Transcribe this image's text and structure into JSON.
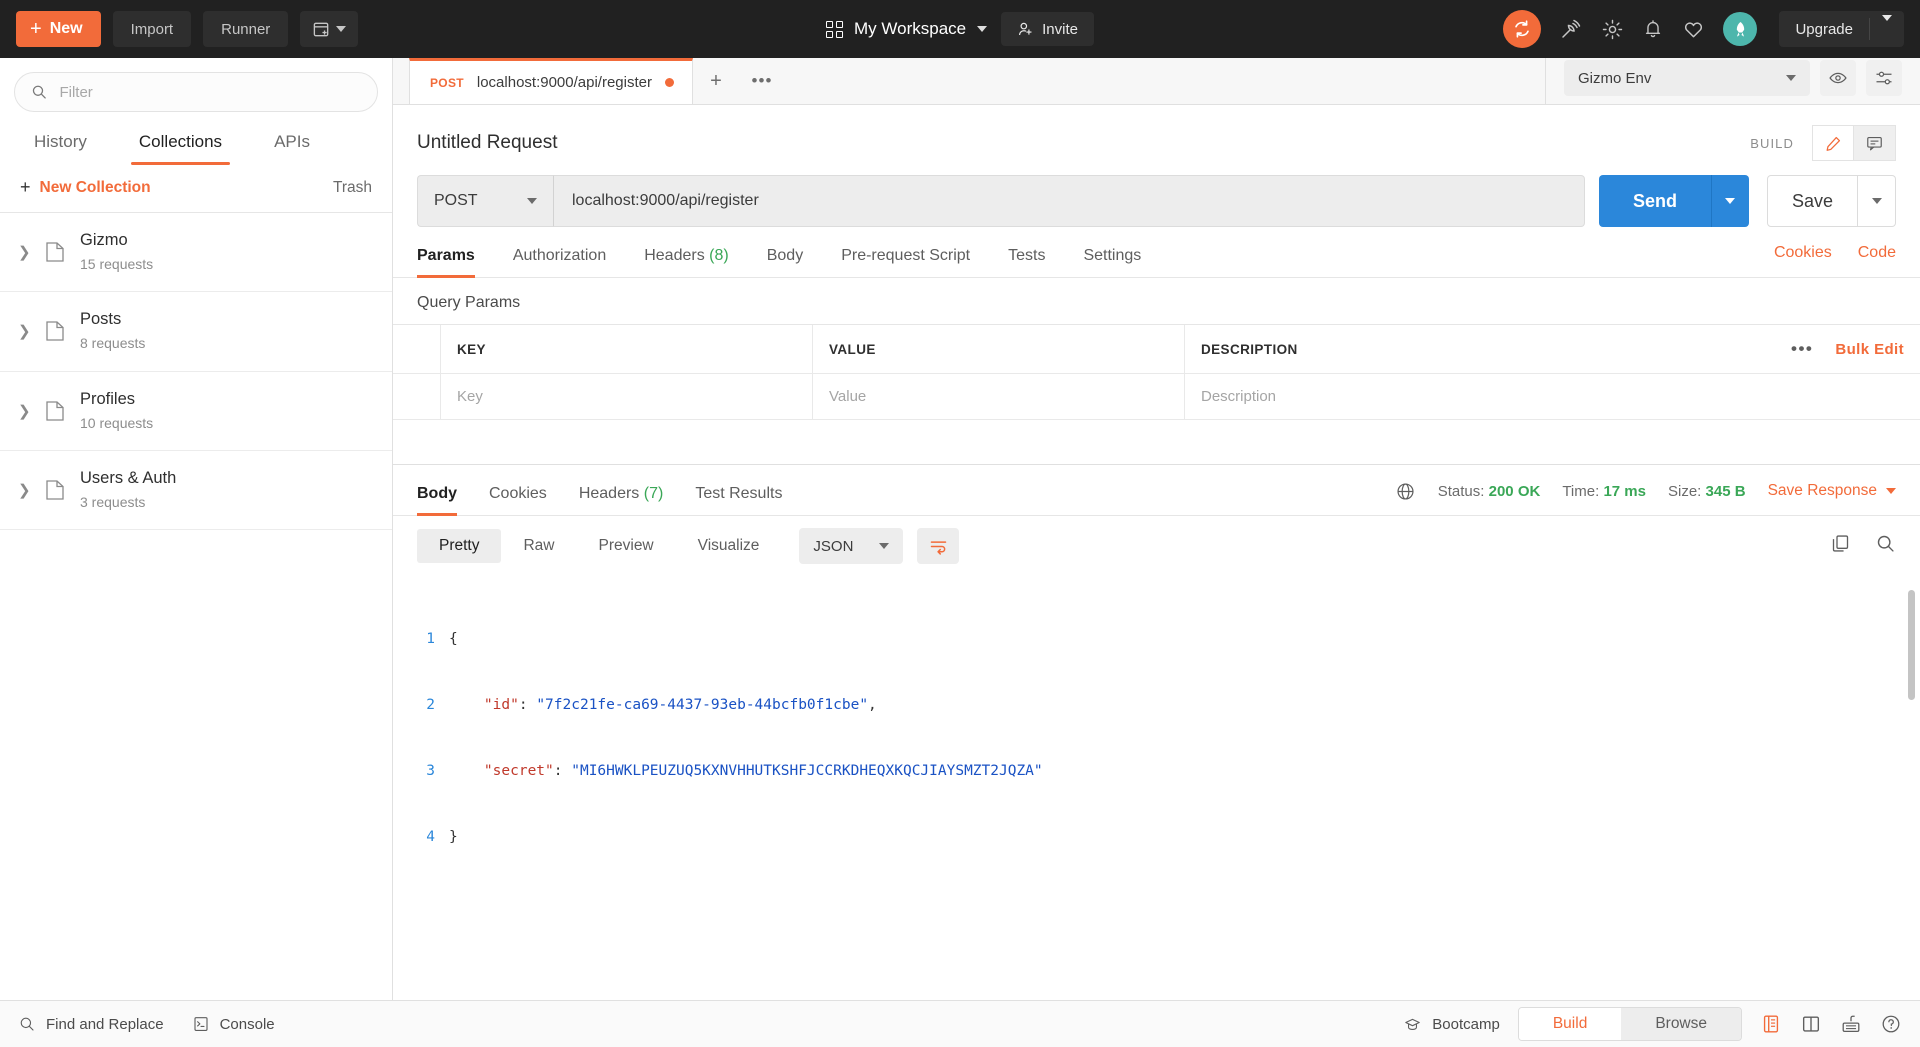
{
  "topbar": {
    "new_label": "New",
    "import_label": "Import",
    "runner_label": "Runner",
    "workspace_label": "My Workspace",
    "invite_label": "Invite",
    "upgrade_label": "Upgrade",
    "icons": [
      "sync-icon",
      "satellite-icon",
      "gear-icon",
      "bell-icon",
      "heart-icon",
      "rocket-avatar"
    ],
    "accent": "#f26b3a",
    "bg": "#212121"
  },
  "sidebar": {
    "filter_placeholder": "Filter",
    "tabs": [
      {
        "label": "History",
        "active": false
      },
      {
        "label": "Collections",
        "active": true
      },
      {
        "label": "APIs",
        "active": false
      }
    ],
    "new_collection_label": "New Collection",
    "trash_label": "Trash",
    "collections": [
      {
        "name": "Gizmo",
        "count": "15 requests"
      },
      {
        "name": "Posts",
        "count": "8 requests"
      },
      {
        "name": "Profiles",
        "count": "10 requests"
      },
      {
        "name": "Users & Auth",
        "count": "3 requests"
      }
    ]
  },
  "tabstrip": {
    "request_tab": {
      "method": "POST",
      "name": "localhost:9000/api/register",
      "unsaved": true
    },
    "environment": "Gizmo Env"
  },
  "request": {
    "title": "Untitled Request",
    "build_label": "BUILD",
    "method": "POST",
    "url": "localhost:9000/api/register",
    "send_label": "Send",
    "save_label": "Save",
    "tabs": [
      {
        "label": "Params",
        "count": "",
        "active": true
      },
      {
        "label": "Authorization",
        "count": "",
        "active": false
      },
      {
        "label": "Headers",
        "count": "(8)",
        "active": false
      },
      {
        "label": "Body",
        "count": "",
        "active": false
      },
      {
        "label": "Pre-request Script",
        "count": "",
        "active": false
      },
      {
        "label": "Tests",
        "count": "",
        "active": false
      },
      {
        "label": "Settings",
        "count": "",
        "active": false
      }
    ],
    "cookies_link": "Cookies",
    "code_link": "Code",
    "query_params_title": "Query Params",
    "params_table": {
      "headers": [
        "KEY",
        "VALUE",
        "DESCRIPTION"
      ],
      "bulk_edit_label": "Bulk Edit",
      "rows": [
        {
          "key": "Key",
          "value": "Value",
          "description": "Description"
        }
      ]
    }
  },
  "response": {
    "tabs": [
      {
        "label": "Body",
        "count": "",
        "active": true
      },
      {
        "label": "Cookies",
        "count": "",
        "active": false
      },
      {
        "label": "Headers",
        "count": "(7)",
        "active": false
      },
      {
        "label": "Test Results",
        "count": "",
        "active": false
      }
    ],
    "status_label": "Status:",
    "status_value": "200 OK",
    "time_label": "Time:",
    "time_value": "17 ms",
    "size_label": "Size:",
    "size_value": "345 B",
    "save_response_label": "Save Response",
    "format_tabs": [
      {
        "label": "Pretty",
        "active": true
      },
      {
        "label": "Raw",
        "active": false
      },
      {
        "label": "Preview",
        "active": false
      },
      {
        "label": "Visualize",
        "active": false
      }
    ],
    "language": "JSON",
    "body_lines": [
      {
        "num": "1",
        "segments": [
          {
            "t": "{",
            "c": "p"
          }
        ]
      },
      {
        "num": "2",
        "segments": [
          {
            "t": "    ",
            "c": "p"
          },
          {
            "t": "\"id\"",
            "c": "k"
          },
          {
            "t": ": ",
            "c": "p"
          },
          {
            "t": "\"7f2c21fe-ca69-4437-93eb-44bcfb0f1cbe\"",
            "c": "s"
          },
          {
            "t": ",",
            "c": "p"
          }
        ]
      },
      {
        "num": "3",
        "segments": [
          {
            "t": "    ",
            "c": "p"
          },
          {
            "t": "\"secret\"",
            "c": "k"
          },
          {
            "t": ": ",
            "c": "p"
          },
          {
            "t": "\"MI6HWKLPEUZUQ5KXNVHHUTKSHFJCCRKDHEQXKQCJIAYSMZT2JQZA\"",
            "c": "s"
          }
        ]
      },
      {
        "num": "4",
        "segments": [
          {
            "t": "}",
            "c": "p"
          }
        ]
      }
    ]
  },
  "footer": {
    "find_replace_label": "Find and Replace",
    "console_label": "Console",
    "bootcamp_label": "Bootcamp",
    "build_label": "Build",
    "browse_label": "Browse"
  }
}
